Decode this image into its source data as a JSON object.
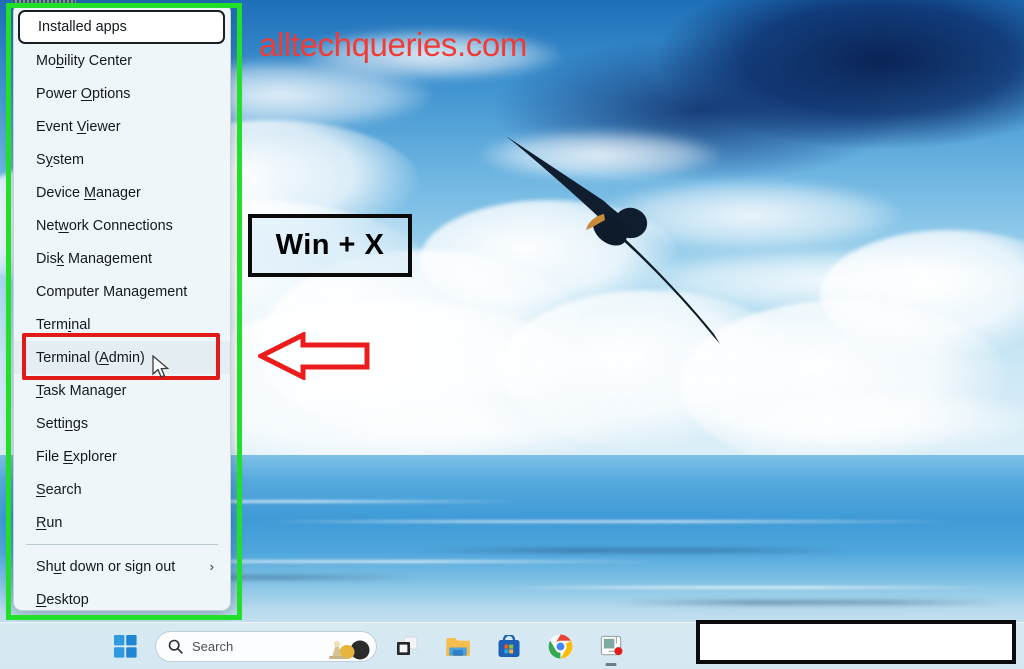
{
  "annotations": {
    "watermark": "alltechqueries.com",
    "shortcut_label": "Win + X",
    "arrow": "left-arrow-red",
    "green_box": "#22E02A",
    "red_box": "#E01B18",
    "watermark_color": "#F23B34"
  },
  "winx_menu": {
    "title": "Win + X quick link menu",
    "items": [
      {
        "label": "Installed apps",
        "accel": "",
        "state": "focused",
        "has_submenu": false
      },
      {
        "label": "Mobility Center",
        "accel": "b",
        "state": "normal",
        "has_submenu": false
      },
      {
        "label": "Power Options",
        "accel": "O",
        "state": "normal",
        "has_submenu": false
      },
      {
        "label": "Event Viewer",
        "accel": "V",
        "state": "normal",
        "has_submenu": false
      },
      {
        "label": "System",
        "accel": "y",
        "state": "normal",
        "has_submenu": false
      },
      {
        "label": "Device Manager",
        "accel": "M",
        "state": "normal",
        "has_submenu": false
      },
      {
        "label": "Network Connections",
        "accel": "w",
        "state": "normal",
        "has_submenu": false
      },
      {
        "label": "Disk Management",
        "accel": "k",
        "state": "normal",
        "has_submenu": false
      },
      {
        "label": "Computer Management",
        "accel": "g",
        "state": "normal",
        "has_submenu": false
      },
      {
        "label": "Terminal",
        "accel": "i",
        "state": "normal",
        "has_submenu": false
      },
      {
        "label": "Terminal (Admin)",
        "accel": "A",
        "state": "highlighted",
        "has_submenu": false
      },
      {
        "label": "Task Manager",
        "accel": "T",
        "state": "normal",
        "has_submenu": false
      },
      {
        "label": "Settings",
        "accel": "n",
        "state": "normal",
        "has_submenu": false
      },
      {
        "label": "File Explorer",
        "accel": "E",
        "state": "normal",
        "has_submenu": false
      },
      {
        "label": "Search",
        "accel": "S",
        "state": "normal",
        "has_submenu": false
      },
      {
        "label": "Run",
        "accel": "R",
        "state": "normal",
        "has_submenu": false
      },
      {
        "label": "Shut down or sign out",
        "accel": "u",
        "state": "normal",
        "has_submenu": true,
        "separator_before": true
      },
      {
        "label": "Desktop",
        "accel": "D",
        "state": "normal",
        "has_submenu": false
      }
    ],
    "submenu_chevron": "›"
  },
  "taskbar": {
    "start_button": "start-button",
    "search": {
      "placeholder": "Search",
      "icon": "search-icon"
    },
    "pinned": [
      {
        "name": "widgets-icon",
        "label": "Widgets"
      },
      {
        "name": "task-view-icon",
        "label": "Task View"
      },
      {
        "name": "file-explorer-icon",
        "label": "File Explorer"
      },
      {
        "name": "microsoft-store-icon",
        "label": "Microsoft Store"
      },
      {
        "name": "google-chrome-icon",
        "label": "Google Chrome"
      },
      {
        "name": "snipping-tool-icon",
        "label": "Snipping Tool"
      }
    ],
    "tray_cover": ""
  },
  "desktop": {
    "wallpaper": "sky-clouds-sea-with-bird"
  }
}
